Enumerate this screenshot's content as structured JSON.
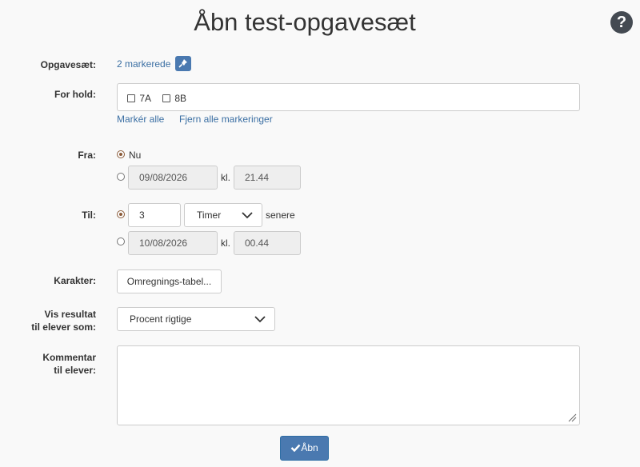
{
  "title": "Åbn test-opgavesæt",
  "help_glyph": "?",
  "opgavesaet": {
    "label": "Opgavesæt:",
    "link": "2 markerede",
    "pin_icon": "pin-icon"
  },
  "hold": {
    "label": "For hold:",
    "options": [
      "7A",
      "8B"
    ],
    "select_all": "Markér alle",
    "clear_all": "Fjern alle markeringer"
  },
  "fra": {
    "label": "Fra:",
    "now_label": "Nu",
    "date": "09/08/2026",
    "kl": "kl.",
    "time": "21.44"
  },
  "til": {
    "label": "Til:",
    "amount": "3",
    "unit": "Timer",
    "after": "senere",
    "date": "10/08/2026",
    "kl": "kl.",
    "time": "00.44"
  },
  "karakter": {
    "label": "Karakter:",
    "button": "Omregnings-tabel..."
  },
  "vis": {
    "label_line1": "Vis resultat",
    "label_line2": "til elever som:",
    "value": "Procent rigtige"
  },
  "kommentar": {
    "label_line1": "Kommentar",
    "label_line2": "til elever:",
    "value": ""
  },
  "submit": {
    "label": "Åbn",
    "icon": "check-icon"
  }
}
